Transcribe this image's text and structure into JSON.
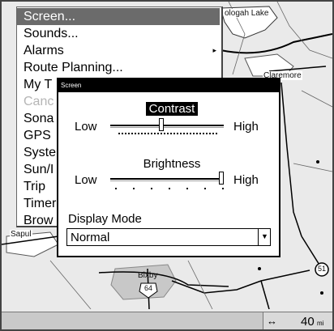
{
  "menu": {
    "items": [
      {
        "label": "Screen...",
        "selected": true,
        "disabled": false
      },
      {
        "label": "Sounds...",
        "selected": false,
        "disabled": false
      },
      {
        "label": "Alarms",
        "selected": false,
        "disabled": false,
        "has_submenu": true
      },
      {
        "label": "Route Planning...",
        "selected": false,
        "disabled": false
      },
      {
        "label": "My T",
        "selected": false,
        "disabled": false
      },
      {
        "label": "Canc",
        "selected": false,
        "disabled": true
      },
      {
        "label": "Sona",
        "selected": false,
        "disabled": false
      },
      {
        "label": "GPS",
        "selected": false,
        "disabled": false
      },
      {
        "label": "Syste",
        "selected": false,
        "disabled": false
      },
      {
        "label": "Sun/I",
        "selected": false,
        "disabled": false
      },
      {
        "label": "Trip",
        "selected": false,
        "disabled": false
      },
      {
        "label": "Timer",
        "selected": false,
        "disabled": false
      },
      {
        "label": "Brow",
        "selected": false,
        "disabled": false
      }
    ],
    "submenu_arrow": "▸"
  },
  "dialog": {
    "title": "Screen",
    "contrast": {
      "label": "Contrast",
      "low": "Low",
      "high": "High",
      "level": 0.45
    },
    "brightness": {
      "label": "Brightness",
      "low": "Low",
      "high": "High",
      "level": 1.0
    },
    "display_mode": {
      "label": "Display Mode",
      "value": "Normal",
      "arrow": "▼"
    }
  },
  "map": {
    "labels": {
      "top": "ologah Lake",
      "right": "Claremore",
      "left": "Sapul",
      "bottom": "Bixby",
      "shield_bottom": "64",
      "shield_right": "51"
    }
  },
  "status": {
    "scale_icon": "↔",
    "scale_value": "40",
    "scale_unit": "mi"
  },
  "colors": {
    "selected_bg": "#6b6b6b",
    "titlebar": "#000000",
    "map_bg": "#eaeaea",
    "water": "#ffffff",
    "road": "#000000"
  }
}
